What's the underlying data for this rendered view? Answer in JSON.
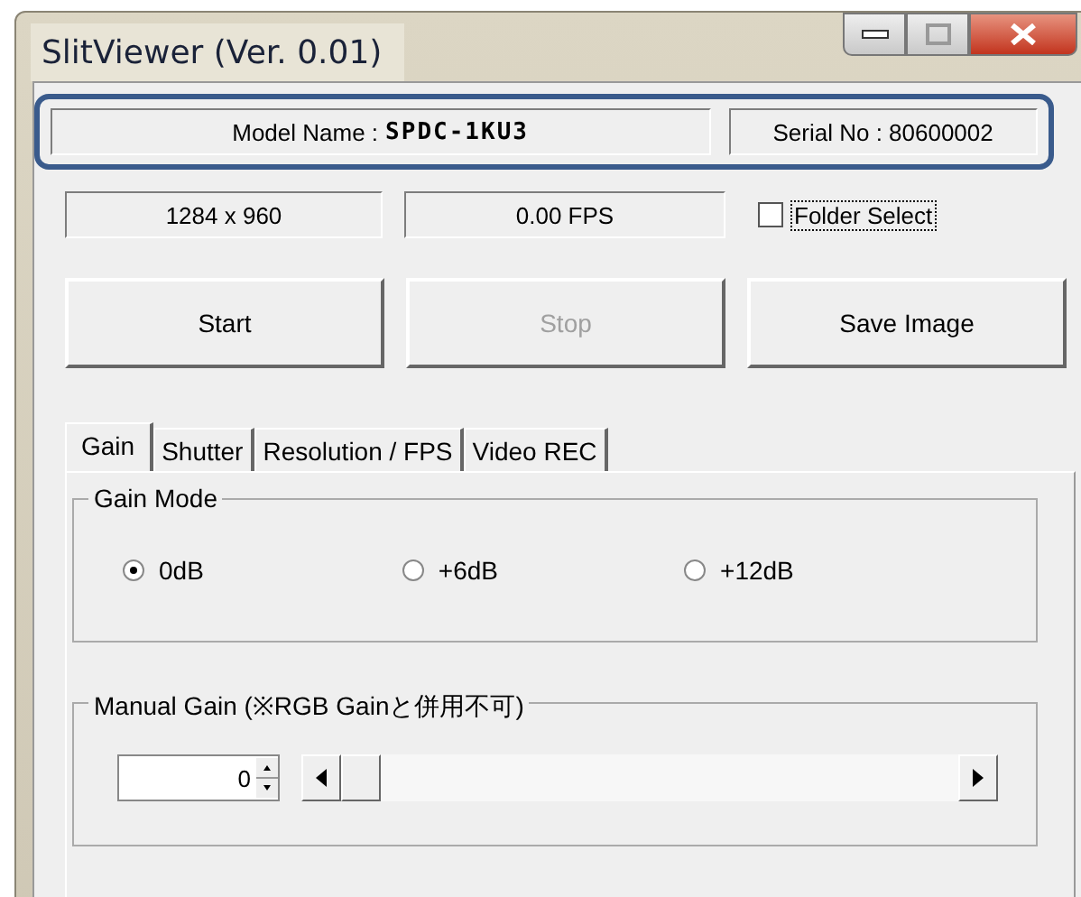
{
  "window": {
    "title": "SlitViewer  (Ver. 0.01)"
  },
  "device": {
    "model_label": "Model Name :",
    "model_value": "SPDC-1KU3",
    "serial": "Serial No : 80600002"
  },
  "status": {
    "resolution": "1284 x 960",
    "fps": "0.00 FPS"
  },
  "folder_select": {
    "label": "Folder Select",
    "checked": false
  },
  "buttons": [
    {
      "label": "Start",
      "disabled": false
    },
    {
      "label": "Stop",
      "disabled": true
    },
    {
      "label": "Save Image",
      "disabled": false
    }
  ],
  "tabs": [
    {
      "label": "Gain",
      "selected": true
    },
    {
      "label": "Shutter",
      "selected": false
    },
    {
      "label": "Resolution / FPS",
      "selected": false
    },
    {
      "label": "Video REC",
      "selected": false
    }
  ],
  "gain_mode": {
    "title": "Gain Mode",
    "options": [
      {
        "label": "0dB",
        "selected": true
      },
      {
        "label": "+6dB",
        "selected": false
      },
      {
        "label": "+12dB",
        "selected": false
      }
    ]
  },
  "manual_gain": {
    "title": "Manual Gain (※RGB Gainと併用不可)",
    "value": "0"
  }
}
